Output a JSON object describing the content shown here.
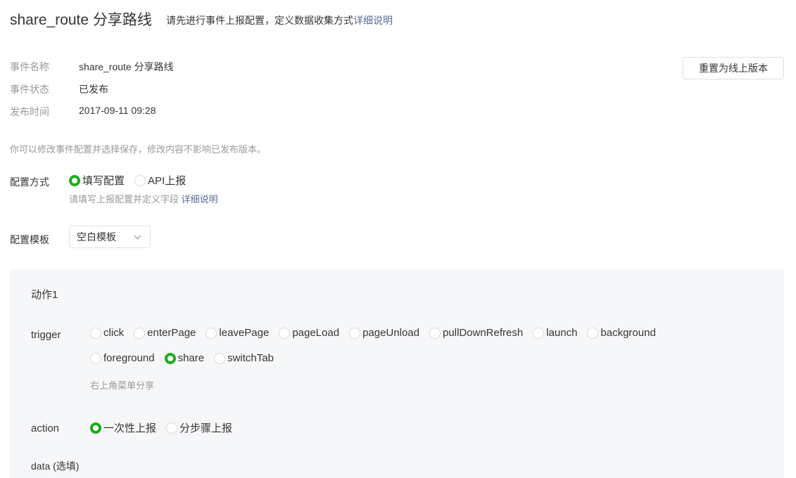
{
  "header": {
    "title": "share_route 分享路线",
    "subtitle": "请先进行事件上报配置，定义数据收集方式",
    "subtitle_link": "详细说明"
  },
  "info": {
    "name_label": "事件名称",
    "name_value": "share_route 分享路线",
    "status_label": "事件状态",
    "status_value": "已发布",
    "time_label": "发布时间",
    "time_value": "2017-09-11 09:28"
  },
  "reset_button": "重置为线上版本",
  "notice": "你可以修改事件配置并选择保存，修改内容不影响已发布版本。",
  "config_mode": {
    "label": "配置方式",
    "options": [
      {
        "label": "填写配置",
        "checked": true
      },
      {
        "label": "API上报",
        "checked": false
      }
    ],
    "hint": "请填写上报配置并定义字段",
    "hint_link": "详细说明"
  },
  "template": {
    "label": "配置模板",
    "selected": "空白模板"
  },
  "action_panel": {
    "title": "动作1",
    "trigger_label": "trigger",
    "triggers": [
      {
        "label": "click"
      },
      {
        "label": "enterPage"
      },
      {
        "label": "leavePage"
      },
      {
        "label": "pageLoad"
      },
      {
        "label": "pageUnload"
      },
      {
        "label": "pullDownRefresh"
      },
      {
        "label": "launch"
      },
      {
        "label": "background"
      },
      {
        "label": "foreground"
      },
      {
        "label": "share",
        "checked": true
      },
      {
        "label": "switchTab"
      }
    ],
    "trigger_hint": "右上角菜单分享",
    "action_label": "action",
    "actions": [
      {
        "label": "一次性上报",
        "checked": true
      },
      {
        "label": "分步骤上报"
      }
    ],
    "data_label": "data (选填)"
  },
  "colors": {
    "accent": "#1aad19",
    "link": "#576b95"
  }
}
